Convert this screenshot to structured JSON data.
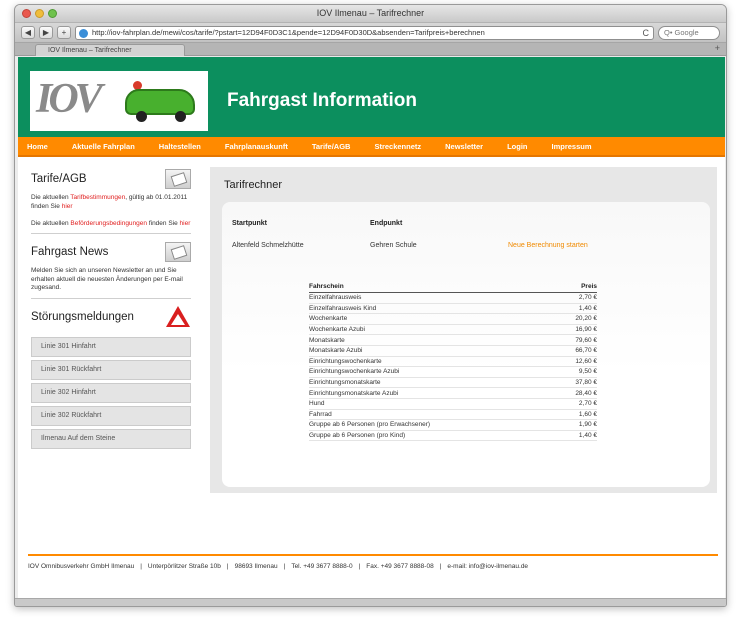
{
  "browser": {
    "window_title": "IOV Ilmenau – Tarifrechner",
    "url": "http://iov-fahrplan.de/mewi/cos/tarife/?pstart=12D94F0D3C1&pende=12D94F0D30D&absenden=Tarifpreis+berechnen",
    "search_placeholder": "Q• Google",
    "tab_label": "IOV Ilmenau – Tarifrechner",
    "back_glyph": "◀",
    "forward_glyph": "▶",
    "add_glyph": "+",
    "reload_glyph": "C",
    "tab_add_glyph": "+"
  },
  "header": {
    "logo_text": "IOV",
    "title": "Fahrgast Information"
  },
  "nav": [
    "Home",
    "Aktuelle Fahrplan",
    "Haltestellen",
    "Fahrplanauskunft",
    "Tarife/AGB",
    "Streckennetz",
    "Newsletter",
    "Login",
    "Impressum"
  ],
  "sidebar": {
    "tarife": {
      "title": "Tarife/AGB",
      "p1_a": "Die aktuellen ",
      "p1_link": "Tarifbestimmungen",
      "p1_b": ", gültig ab 01.01.2011 finden Sie ",
      "p1_here": "hier",
      "p2_a": "Die aktuellen ",
      "p2_link": "Beförderungsbedingungen",
      "p2_b": " finden Sie ",
      "p2_here": "hier"
    },
    "news": {
      "title": "Fahrgast News",
      "text": "Melden Sie sich an unseren Newsletter an und Sie erhalten aktuell die neuesten Änderungen per E-mail zugesand."
    },
    "stoerungen": {
      "title": "Störungsmeldungen",
      "items": [
        "Linie 301 Hinfahrt",
        "Linie 301 Rückfahrt",
        "Linie 302 Hinfahrt",
        "Linie 302 Rückfahrt",
        "Ilmenau Auf dem Steine"
      ]
    }
  },
  "main": {
    "title": "Tarifrechner",
    "start_label": "Startpunkt",
    "end_label": "Endpunkt",
    "start_value": "Altenfeld Schmelzhütte",
    "end_value": "Gehren Schule",
    "new_calc": "Neue Berechnung starten",
    "table": {
      "headers": [
        "Fahrschein",
        "Preis"
      ],
      "rows": [
        [
          "Einzelfahrausweis",
          "2,70 €"
        ],
        [
          "Einzelfahrausweis Kind",
          "1,40 €"
        ],
        [
          "Wochenkarte",
          "20,20 €"
        ],
        [
          "Wochenkarte Azubi",
          "16,90 €"
        ],
        [
          "Monatskarte",
          "79,60 €"
        ],
        [
          "Monatskarte Azubi",
          "66,70 €"
        ],
        [
          "Einrichtungswochenkarte",
          "12,60 €"
        ],
        [
          "Einrichtungswochenkarte Azubi",
          "9,50 €"
        ],
        [
          "Einrichtungsmonatskarte",
          "37,80 €"
        ],
        [
          "Einrichtungsmonatskarte Azubi",
          "28,40 €"
        ],
        [
          "Hund",
          "2,70 €"
        ],
        [
          "Fahrrad",
          "1,60 €"
        ],
        [
          "Gruppe ab 6 Personen (pro Erwachsener)",
          "1,90 €"
        ],
        [
          "Gruppe ab 6 Personen (pro Kind)",
          "1,40 €"
        ]
      ]
    }
  },
  "footer": {
    "company": "IOV Omnibusverkehr GmbH Ilmenau",
    "street": "Unterpörlitzer Straße 10b",
    "city": "98693 Ilmenau",
    "phone": "Tel. +49 3677 8888-0",
    "fax": "Fax. +49 3677 8888-08",
    "email": "e-mail: info@iov-ilmenau.de",
    "separator": "|"
  },
  "colors": {
    "header_green": "#0c8f5e",
    "nav_orange": "#ff8a00",
    "link_red": "#e02020"
  }
}
